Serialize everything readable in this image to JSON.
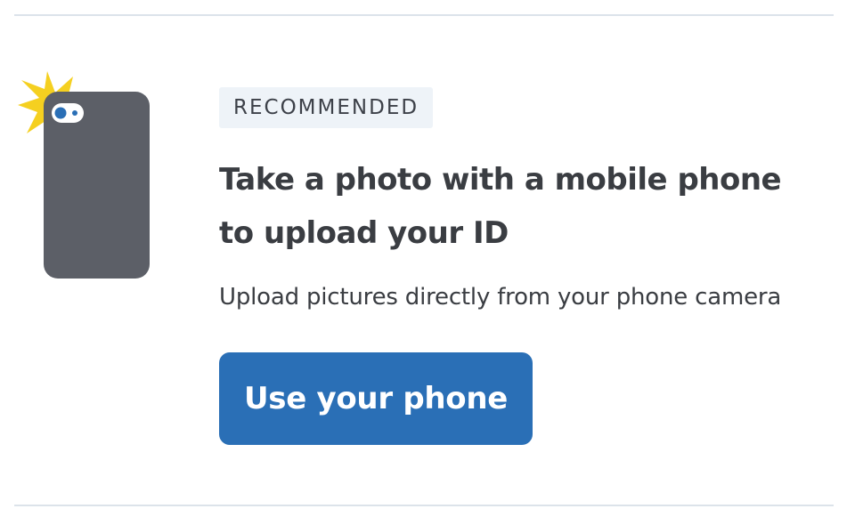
{
  "option": {
    "badge": "RECOMMENDED",
    "title": "Take a photo with a mobile phone to upload your ID",
    "description": "Upload pictures directly from your phone camera",
    "button_label": "Use your phone"
  },
  "illustration": {
    "icon": "phone-camera-flash-icon",
    "colors": {
      "phone_body": "#5c5f67",
      "flash": "#f5d020",
      "lens": "#2a6fb6"
    }
  },
  "colors": {
    "accent": "#2a6fb6",
    "text": "#3a3d42",
    "badge_bg": "#eef3f8",
    "divider": "#dce3ea"
  }
}
